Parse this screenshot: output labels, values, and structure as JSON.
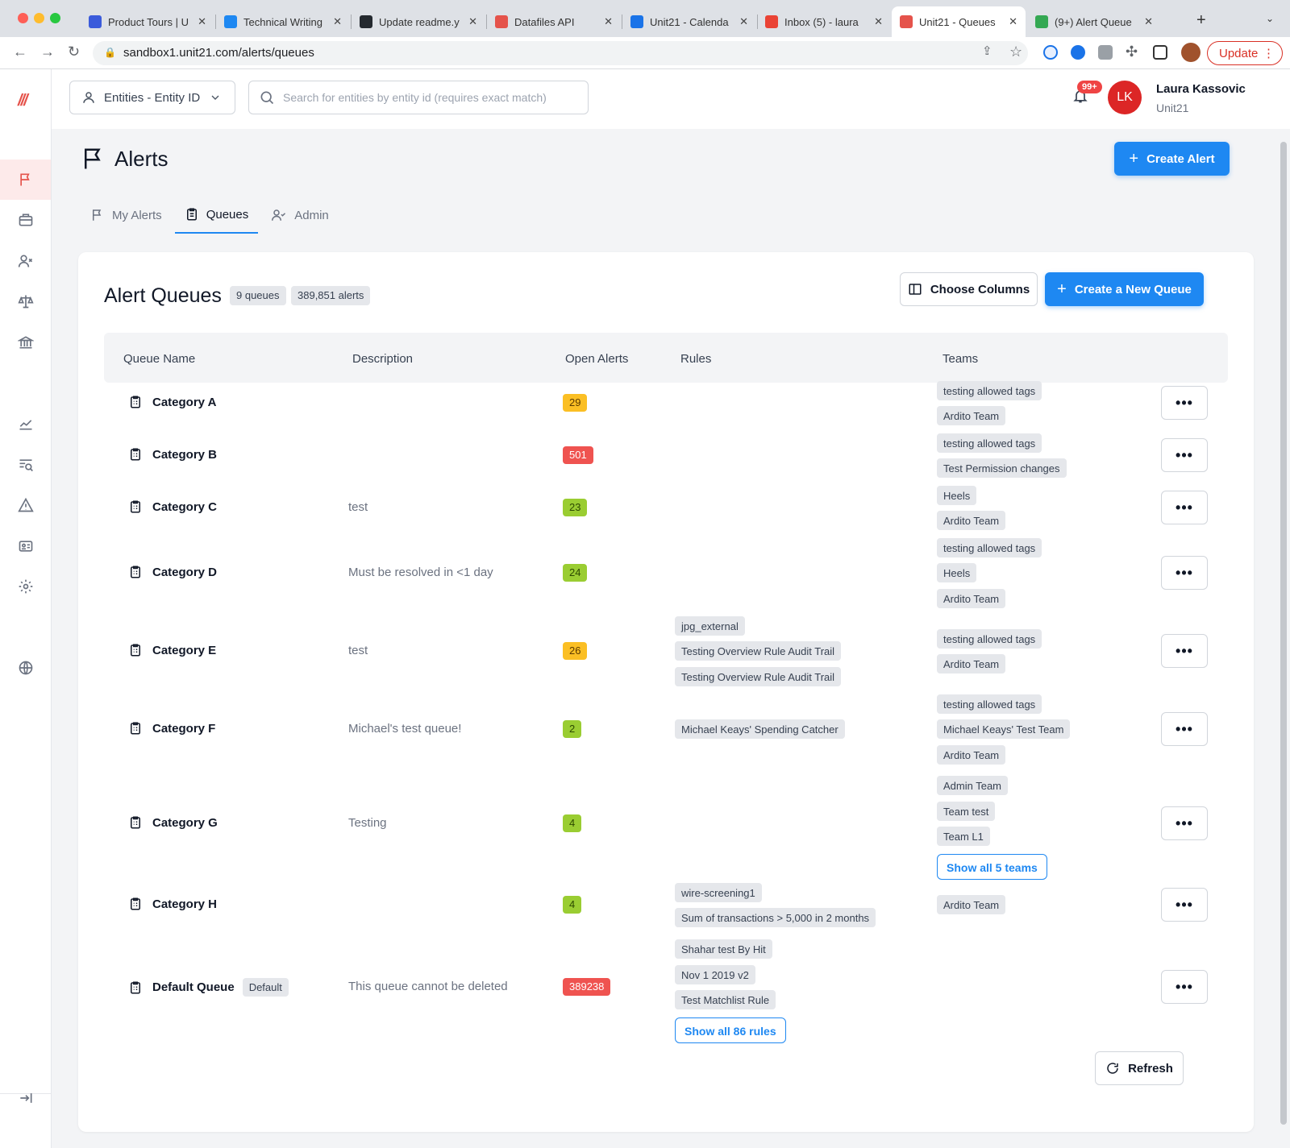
{
  "browser": {
    "tabs": [
      {
        "label": "Product Tours | U",
        "color": "#3b5bdb"
      },
      {
        "label": "Technical Writing",
        "color": "#1e88f2"
      },
      {
        "label": "Update readme.y",
        "color": "#24292f"
      },
      {
        "label": "Datafiles API",
        "color": "#e5534b"
      },
      {
        "label": "Unit21 - Calenda",
        "color": "#1a73e8"
      },
      {
        "label": "Inbox (5) - laura",
        "color": "#ea4335"
      },
      {
        "label": "Unit21 - Queues",
        "color": "#e5534b"
      },
      {
        "label": "(9+) Alert Queue",
        "color": "#34a853"
      }
    ],
    "url": "sandbox1.unit21.com/alerts/queues",
    "update_label": "Update"
  },
  "header": {
    "entity_select": "Entities - Entity ID",
    "search_placeholder": "Search for entities by entity id (requires exact match)",
    "notifications": "99+",
    "avatar_initials": "LK",
    "user_name": "Laura Kassovic",
    "user_org": "Unit21"
  },
  "page": {
    "title": "Alerts",
    "create_alert": "Create Alert",
    "tabs": [
      "My Alerts",
      "Queues",
      "Admin"
    ]
  },
  "queues_card": {
    "title": "Alert Queues",
    "queue_count": "9 queues",
    "alert_count": "389,851 alerts",
    "choose_columns": "Choose Columns",
    "create_queue": "Create a New Queue",
    "columns": [
      "Queue Name",
      "Description",
      "Open Alerts",
      "Rules",
      "Teams"
    ],
    "refresh": "Refresh",
    "rows": [
      {
        "name": "Category A",
        "description": "",
        "open": "29",
        "status": "amber",
        "rules": [],
        "teams": [
          "testing allowed tags",
          "Ardito Team"
        ]
      },
      {
        "name": "Category B",
        "description": "",
        "open": "501",
        "status": "red",
        "rules": [],
        "teams": [
          "testing allowed tags",
          "Test Permission changes"
        ]
      },
      {
        "name": "Category C",
        "description": "test",
        "open": "23",
        "status": "green",
        "rules": [],
        "teams": [
          "Heels",
          "Ardito Team"
        ]
      },
      {
        "name": "Category D",
        "description": "Must be resolved in <1 day",
        "open": "24",
        "status": "green",
        "rules": [],
        "teams": [
          "testing allowed tags",
          "Heels",
          "Ardito Team"
        ]
      },
      {
        "name": "Category E",
        "description": "test",
        "open": "26",
        "status": "amber",
        "rules": [
          "jpg_external",
          "Testing Overview Rule Audit Trail",
          "Testing Overview Rule Audit Trail"
        ],
        "teams": [
          "testing allowed tags",
          "Ardito Team"
        ]
      },
      {
        "name": "Category F",
        "description": "Michael's test queue!",
        "open": "2",
        "status": "green",
        "rules": [
          "Michael Keays' Spending Catcher"
        ],
        "teams": [
          "testing allowed tags",
          "Michael Keays' Test Team",
          "Ardito Team"
        ]
      },
      {
        "name": "Category G",
        "description": "Testing",
        "open": "4",
        "status": "green",
        "rules": [],
        "teams": [
          "Admin Team",
          "Team test",
          "Team L1"
        ],
        "teams_more": "Show all 5 teams"
      },
      {
        "name": "Category H",
        "description": "",
        "open": "4",
        "status": "green",
        "rules": [
          "wire-screening1",
          "Sum of transactions > 5,000 in 2 months"
        ],
        "teams": [
          "Ardito Team"
        ]
      },
      {
        "name": "Default Queue",
        "badge": "Default",
        "description": "This queue cannot be deleted",
        "open": "389238",
        "status": "red",
        "rules": [
          "Shahar test By Hit",
          "Nov 1 2019 v2",
          "Test Matchlist Rule"
        ],
        "rules_more": "Show all 86 rules",
        "teams": []
      }
    ]
  },
  "icons": [
    "flag-icon",
    "briefcase-icon",
    "user-x-icon",
    "scale-icon",
    "bank-icon",
    "chart-icon",
    "search-list-icon",
    "warning-icon",
    "id-card-icon",
    "gear-icon",
    "globe-icon",
    "collapse-icon",
    "clipboard-icon",
    "bell-icon",
    "search-icon",
    "user-icon",
    "chevron-down-icon",
    "columns-icon",
    "refresh-icon"
  ]
}
